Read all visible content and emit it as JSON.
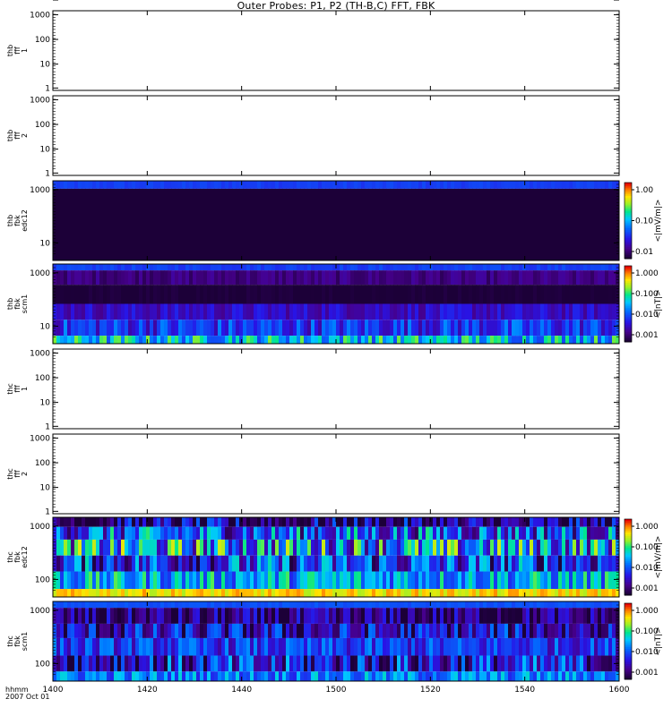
{
  "chart_data": {
    "type": "heatmap",
    "title": "Outer Probes: P1, P2 (TH-B,C) FFT, FBK",
    "x_ticks": [
      "1400",
      "1420",
      "1440",
      "1500",
      "1520",
      "1540",
      "1600"
    ],
    "x_footer": [
      "hhmm",
      "2007 Oct 01"
    ],
    "panels": [
      {
        "label": [
          "thb",
          "fff",
          "1"
        ],
        "yticks": [
          "1000",
          "100",
          "10",
          "1"
        ],
        "empty": true
      },
      {
        "label": [
          "thb",
          "fff",
          "2"
        ],
        "yticks": [
          "1000",
          "100",
          "10",
          "1"
        ],
        "empty": true
      },
      {
        "label": [
          "thb",
          "fbk",
          "edc12"
        ],
        "yticks": [
          "1000",
          "10"
        ],
        "empty": false,
        "colorbar": {
          "label": "<|mV/m|>",
          "ticks": [
            "1.00",
            "0.10",
            "0.01"
          ]
        }
      },
      {
        "label": [
          "thb",
          "fbk",
          "scm1"
        ],
        "yticks": [
          "1000",
          "10"
        ],
        "empty": false,
        "colorbar": {
          "label": "<|nT|>",
          "ticks": [
            "1.000",
            "0.100",
            "0.010",
            "0.001"
          ]
        }
      },
      {
        "label": [
          "thc",
          "fff",
          "1"
        ],
        "yticks": [
          "1000",
          "100",
          "10",
          "1"
        ],
        "empty": true
      },
      {
        "label": [
          "thc",
          "fff",
          "2"
        ],
        "yticks": [
          "1000",
          "100",
          "10",
          "1"
        ],
        "empty": true
      },
      {
        "label": [
          "thc",
          "fbk",
          "edc12"
        ],
        "yticks": [
          "1000",
          "100",
          "10"
        ],
        "empty": false,
        "colorbar": {
          "label": "<|mV/m|>",
          "ticks": [
            "1.000",
            "0.100",
            "0.010",
            "0.001"
          ]
        }
      },
      {
        "label": [
          "thc",
          "fbk",
          "scm1"
        ],
        "yticks": [
          "1000",
          "100",
          "10"
        ],
        "empty": false,
        "colorbar": {
          "label": "<|nT|>",
          "ticks": [
            "1.000",
            "0.100",
            "0.010",
            "0.001"
          ]
        }
      }
    ]
  }
}
